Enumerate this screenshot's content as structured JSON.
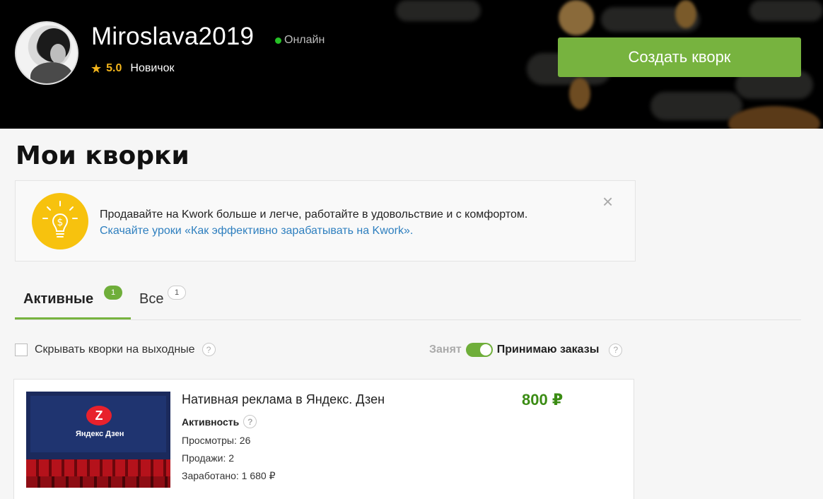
{
  "profile": {
    "username": "Miroslava2019",
    "status": "Онлайн",
    "rating": "5.0",
    "level": "Новичок",
    "create_button": "Создать кворк"
  },
  "page": {
    "title": "Мои кворки"
  },
  "promo": {
    "text": "Продавайте на Kwork больше и легче, работайте в удовольствие и с комфортом.",
    "link": "Скачайте уроки «Как эффективно зарабатывать на Kwork».",
    "close": "×"
  },
  "tabs": [
    {
      "label": "Активные",
      "count": "1"
    },
    {
      "label": "Все",
      "count": "1"
    }
  ],
  "controls": {
    "hide_weekend": "Скрывать кворки на выходные",
    "help": "?",
    "busy": "Занят",
    "accepting": "Принимаю заказы"
  },
  "kwork": {
    "title": "Нативная реклама в Яндекс. Дзен",
    "price": "800 ₽",
    "activity_label": "Активность",
    "views": "Просмотры: 26",
    "sales": "Продажи: 2",
    "earned": "Заработано: 1 680 ₽",
    "thumb_text": "Яндекс Дзен"
  },
  "colors": {
    "accent_green": "#77b33f",
    "price_green": "#3b8c14",
    "link_blue": "#2e7fbf",
    "star": "#f2b41b"
  }
}
